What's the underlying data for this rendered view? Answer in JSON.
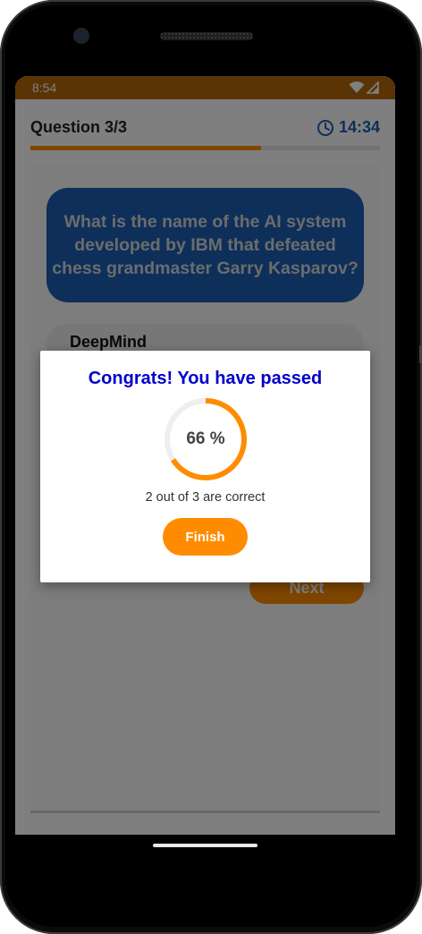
{
  "status_bar": {
    "time": "8:54"
  },
  "quiz": {
    "question_counter": "Question 3/3",
    "timer": "14:34",
    "progress": 0.66,
    "question": "What is the name of the AI system developed by IBM that defeated chess grandmaster Garry Kasparov?",
    "options": [
      "DeepMind"
    ],
    "next_label": "Next"
  },
  "dialog": {
    "title": "Congrats! You have passed",
    "percent_text": "66 %",
    "percent": 66,
    "score_text": "2 out of 3 are correct",
    "finish_label": "Finish"
  },
  "colors": {
    "accent": "#ff8c00",
    "primary": "#1a5fb4",
    "title": "#0000cc",
    "status_bar": "#b5680b"
  },
  "icons": {
    "timer": "clock-icon",
    "wifi": "wifi-icon",
    "signal": "signal-icon"
  }
}
